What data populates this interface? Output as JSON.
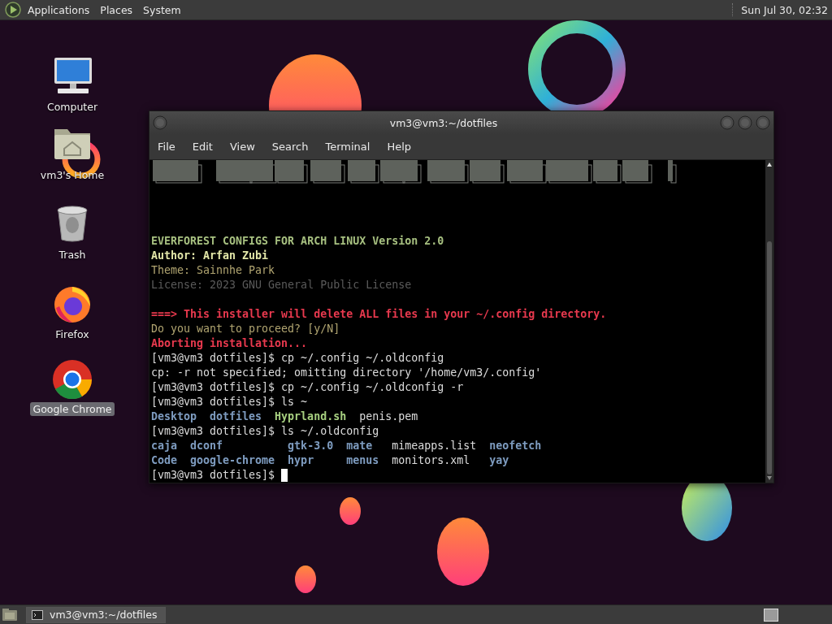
{
  "top_panel": {
    "menus": [
      "Applications",
      "Places",
      "System"
    ],
    "clock": "Sun Jul 30, 02:32"
  },
  "desktop_icons": [
    {
      "kind": "computer",
      "label": "Computer",
      "selected": false
    },
    {
      "kind": "home",
      "label": "vm3's Home",
      "selected": false
    },
    {
      "kind": "trash",
      "label": "Trash",
      "selected": false
    },
    {
      "kind": "firefox",
      "label": "Firefox",
      "selected": false
    },
    {
      "kind": "chrome",
      "label": "Google Chrome",
      "selected": true
    }
  ],
  "terminal": {
    "title": "vm3@vm3:~/dotfiles",
    "menu": [
      "File",
      "Edit",
      "View",
      "Search",
      "Terminal",
      "Help"
    ],
    "lines": [
      {
        "kind": "text",
        "segments": [
          {
            "text": "EVERFOREST CONFIGS FOR ARCH LINUX Version 2.0",
            "kind": "title"
          }
        ]
      },
      {
        "kind": "text",
        "segments": [
          {
            "text": "Author: Arfan Zubi",
            "kind": "author"
          }
        ]
      },
      {
        "kind": "text",
        "segments": [
          {
            "text": "Theme: Sainnhe Park",
            "kind": "theme"
          }
        ]
      },
      {
        "kind": "text",
        "segments": [
          {
            "text": "License: 2023 GNU General Public License",
            "kind": "license"
          }
        ]
      },
      {
        "kind": "blank"
      },
      {
        "kind": "text",
        "segments": [
          {
            "text": "===> This installer will delete ALL files in your ~/.config directory.",
            "kind": "warning"
          }
        ]
      },
      {
        "kind": "text",
        "segments": [
          {
            "text": "Do you want to proceed? [y/N]",
            "kind": "theme"
          }
        ]
      },
      {
        "kind": "text",
        "segments": [
          {
            "text": "Aborting installation...",
            "kind": "warning"
          }
        ]
      },
      {
        "kind": "text",
        "segments": [
          {
            "text": "[vm3@vm3 dotfiles]$ cp ~/.config ~/.oldconfig",
            "kind": "plain"
          }
        ]
      },
      {
        "kind": "text",
        "segments": [
          {
            "text": "cp: -r not specified; omitting directory '/home/vm3/.config'",
            "kind": "plain"
          }
        ]
      },
      {
        "kind": "text",
        "segments": [
          {
            "text": "[vm3@vm3 dotfiles]$ cp ~/.config ~/.oldconfig -r",
            "kind": "plain"
          }
        ]
      },
      {
        "kind": "text",
        "segments": [
          {
            "text": "[vm3@vm3 dotfiles]$ ls ~",
            "kind": "plain"
          }
        ]
      },
      {
        "kind": "ls",
        "rows": [
          [
            {
              "text": "Desktop",
              "kind": "dir"
            },
            {
              "text": "dotfiles",
              "kind": "dir"
            },
            {
              "text": "Hyprland.sh",
              "kind": "exec"
            },
            {
              "text": "penis.pem",
              "kind": "plain"
            }
          ]
        ]
      },
      {
        "kind": "text",
        "segments": [
          {
            "text": "[vm3@vm3 dotfiles]$ ls ~/.oldconfig",
            "kind": "plain"
          }
        ]
      },
      {
        "kind": "ls",
        "rows": [
          [
            {
              "text": "caja",
              "kind": "dir"
            },
            {
              "text": "dconf",
              "kind": "dir"
            },
            {
              "text": "gtk-3.0",
              "kind": "dir"
            },
            {
              "text": "mate",
              "kind": "dir"
            },
            {
              "text": "mimeapps.list",
              "kind": "plain"
            },
            {
              "text": "neofetch",
              "kind": "dir"
            }
          ],
          [
            {
              "text": "Code",
              "kind": "dir"
            },
            {
              "text": "google-chrome",
              "kind": "dir"
            },
            {
              "text": "hypr",
              "kind": "dir"
            },
            {
              "text": "menus",
              "kind": "dir"
            },
            {
              "text": "monitors.xml",
              "kind": "plain"
            },
            {
              "text": "yay",
              "kind": "dir"
            }
          ]
        ]
      },
      {
        "kind": "text",
        "cursor": true,
        "segments": [
          {
            "text": "[vm3@vm3 dotfiles]$",
            "kind": "plain"
          }
        ]
      }
    ]
  },
  "bottom_panel": {
    "tasks": [
      {
        "label": "vm3@vm3:~/dotfiles",
        "selected": true
      }
    ]
  }
}
